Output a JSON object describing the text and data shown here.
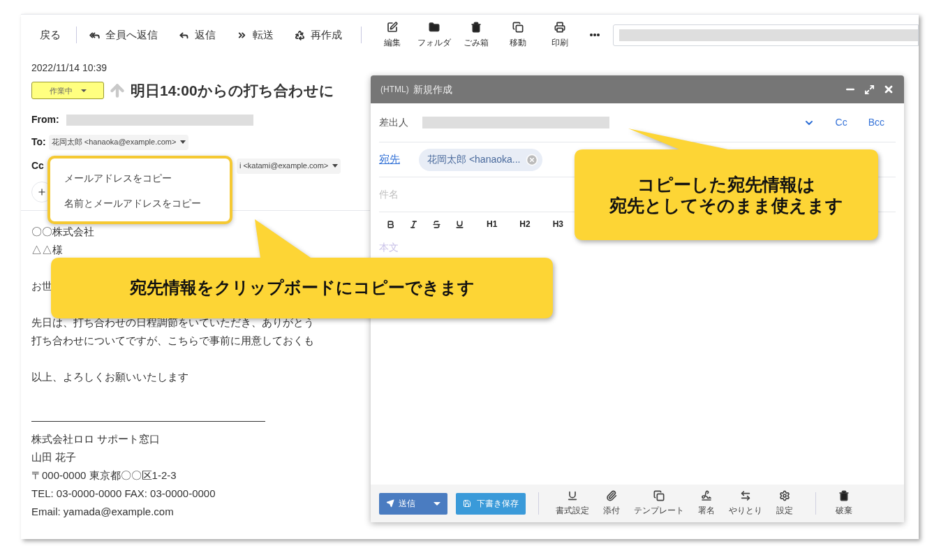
{
  "toolbar": {
    "back": "戻る",
    "actions": [
      {
        "label": "全員へ返信"
      },
      {
        "label": "返信"
      },
      {
        "label": "転送"
      },
      {
        "label": "再作成"
      }
    ],
    "tools": [
      {
        "label": "編集"
      },
      {
        "label": "フォルダ"
      },
      {
        "label": "ごみ箱"
      },
      {
        "label": "移動"
      },
      {
        "label": "印刷"
      }
    ]
  },
  "message": {
    "date": "2022/11/14 10:39",
    "status": "作業中",
    "subject": "明日14:00からの打ち合わせに",
    "from_label": "From:",
    "to_label": "To:",
    "to": "花岡太郎 <hanaoka@example.com>",
    "cc_label": "Cc",
    "cc": "i <katami@example.com>",
    "body": [
      [
        "〇〇株式会社",
        "△△様"
      ],
      [
        "お世"
      ],
      [
        "先日は、打ち合わせの日程調節をいていただき、ありがとう",
        "打ち合わせについてですが、こちらで事前に用意しておくも"
      ],
      [
        "以上、よろしくお願いいたします"
      ]
    ],
    "signature": [
      "株式会社ロロ サポート窓口",
      "山田 花子",
      "〒000-0000 東京都〇〇区1-2-3",
      "TEL: 03-0000-0000 FAX: 03-0000-0000",
      "Email: yamada@example.com"
    ]
  },
  "context_menu": {
    "items": [
      "メールアドレスをコピー",
      "名前とメールアドレスをコピー"
    ]
  },
  "compose": {
    "title_prefix": "(HTML)",
    "title": "新規作成",
    "from_label": "差出人",
    "cc": "Cc",
    "bcc": "Bcc",
    "to_label": "宛先",
    "recipient": "花岡太郎 <hanaoka...",
    "subject_placeholder": "件名",
    "headings": [
      "H1",
      "H2",
      "H3"
    ],
    "body_placeholder": "本文",
    "send": "送信",
    "save_draft": "下書き保存",
    "tools": [
      {
        "label": "書式設定"
      },
      {
        "label": "添付"
      },
      {
        "label": "テンプレート"
      },
      {
        "label": "署名"
      },
      {
        "label": "やりとり"
      },
      {
        "label": "設定"
      }
    ],
    "discard": "破棄"
  },
  "callouts": [
    {
      "lines": [
        "宛先情報をクリップボードにコピーできます"
      ]
    },
    {
      "lines": [
        "コピーした宛先情報は",
        "宛先としてそのまま使えます"
      ]
    }
  ]
}
